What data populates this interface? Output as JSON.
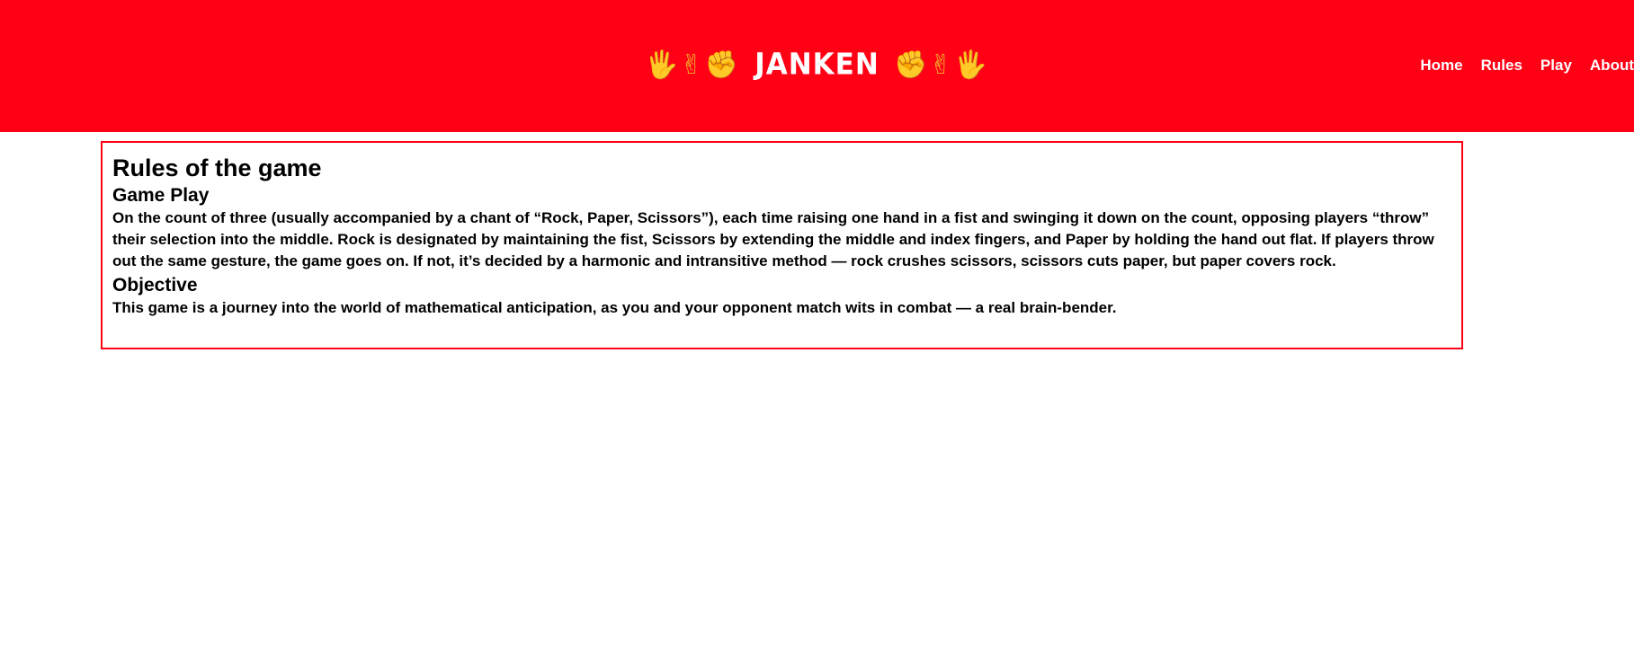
{
  "header": {
    "emoji_left": "🖐✌✊",
    "title": "JANKEN",
    "emoji_right": "✊✌🖐",
    "background": "#ff0015"
  },
  "nav": {
    "items": [
      {
        "label": "Home"
      },
      {
        "label": "Rules"
      },
      {
        "label": "Play"
      },
      {
        "label": "About"
      }
    ]
  },
  "rules": {
    "title": "Rules of the game",
    "sections": [
      {
        "heading": "Game Play",
        "text": "On the count of three (usually accompanied by a chant of “Rock, Paper, Scissors”), each time raising one hand in a fist and swinging it down on the count, opposing players “throw” their selection into the middle. Rock is designated by maintaining the fist, Scissors by extending the middle and index fingers, and Paper by holding the hand out flat. If players throw out the same gesture, the game goes on. If not, it’s decided by a harmonic and intransitive method — rock crushes scissors, scissors cuts paper, but paper covers rock."
      },
      {
        "heading": "Objective",
        "text": "This game is a journey into the world of mathematical anticipation, as you and your opponent match wits in combat — a real brain-bender."
      }
    ],
    "border_color": "#ff0015"
  }
}
